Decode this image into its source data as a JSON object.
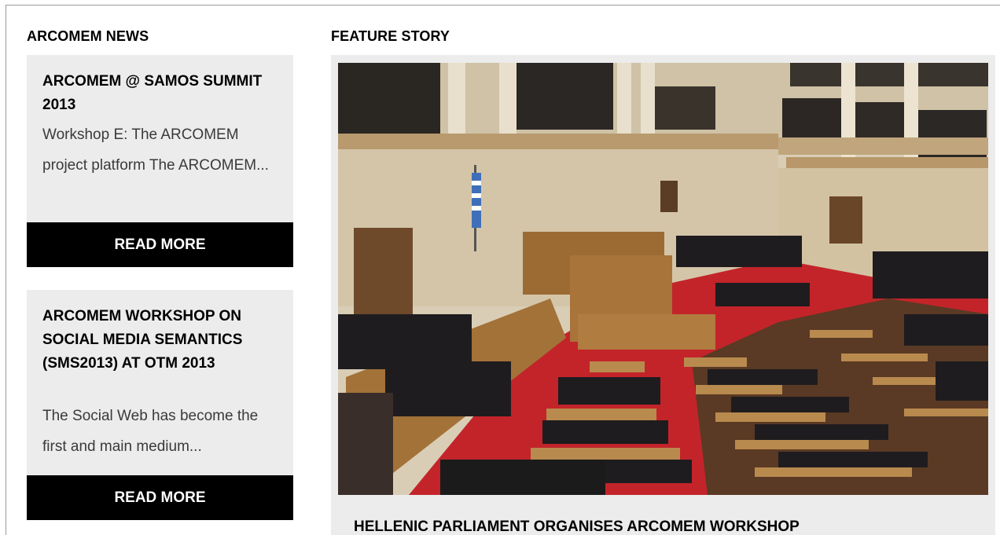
{
  "news": {
    "heading": "ARCOMEM NEWS",
    "items": [
      {
        "title": "ARCOMEM @ SAMOS SUMMIT 2013",
        "excerpt": "Workshop E: The ARCOMEM project platform The ARCOMEM...",
        "button_label": "READ MORE"
      },
      {
        "title": "ARCOMEM WORKSHOP ON SOCIAL MEDIA SEMANTICS (SMS2013) AT OTM 2013",
        "excerpt": "The Social Web has become the first and main medium...",
        "button_label": "READ MORE"
      }
    ]
  },
  "feature": {
    "heading": "FEATURE STORY",
    "title": "HELLENIC PARLIAMENT ORGANISES ARCOMEM WORKSHOP"
  },
  "colors": {
    "card_background": "#ececec",
    "button_background": "#000000",
    "button_text": "#ffffff",
    "excerpt_text": "#3a3a3a"
  }
}
